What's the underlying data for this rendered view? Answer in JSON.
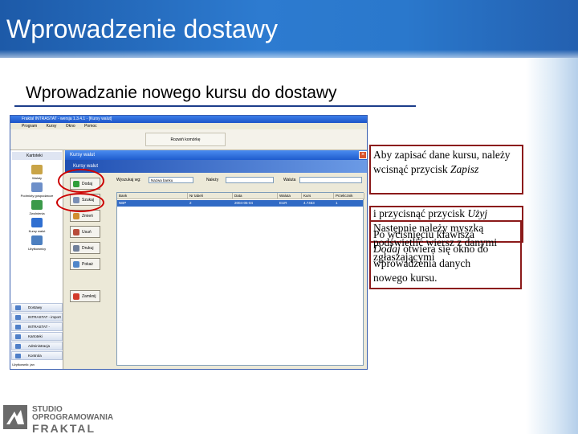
{
  "header": {
    "title": "Wprowadzenie dostawy"
  },
  "subtitle": "Wprowadzanie nowego kursu do dostawy",
  "app": {
    "window_title": "Fraktal INTRASTAT - wersja 1.3.4.1 - [Kursy walut]",
    "menu": [
      "Program",
      "Kursy",
      "Okno",
      "Pomoc"
    ],
    "toolbar_button": "Rozwiń komórkę",
    "sidebar": {
      "header": "Kartoteki",
      "items": [
        "Waluty",
        "Podmioty gospodarcze",
        "Zwolnienia",
        "Kursy walut",
        "Użytkownicy"
      ],
      "nav": [
        "Dostawy",
        "INTRASTAT - import",
        "INTRASTAT - eksport",
        "Kartoteki",
        "Administracja",
        "Kontrola"
      ],
      "status": "Użytkownik: jan"
    },
    "dialog": {
      "title": "Kursy walut",
      "heading": "Kursy walut",
      "buttons": [
        "Dodaj",
        "Szukaj",
        "Zmień",
        "Usuń",
        "Drukuj",
        "Pokaż",
        "Zamknij"
      ],
      "filter_label_1": "Wyszukaj wg:",
      "filter_value_1": "Nazwa banku",
      "filter_label_2": "Należy",
      "filter_label_3": "Waluta",
      "columns": [
        "Bank",
        "Nr tabeli",
        "Data",
        "Waluta",
        "Kurs",
        "Przelicznik"
      ],
      "row": [
        "NBP",
        "2",
        "2004-05-04",
        "EUR",
        "4.7463",
        "1"
      ]
    }
  },
  "callouts": {
    "first": {
      "text": "Aby zapisać dane kursu, należy wcisnąć przycisk ",
      "emphasis": "Zapisz"
    },
    "second_line1": "i przycisnąć przycisk ",
    "second_emph1": "Użyj",
    "second_line2": "Następnie należy myszką",
    "second_line3": "podświetlić wiersz z danymi",
    "second_line4": "zgłaszającymi",
    "third_line1": "Po wciśnięciu klawisza",
    "third_emph": "Dodaj",
    "third_line2": " otwiera się okno do",
    "third_line3": "wprowadzenia danych",
    "third_line4": "nowego kursu."
  },
  "logo": {
    "line1": "STUDIO",
    "line2": "OPROGRAMOWANIA",
    "line3": "FRAKTAL"
  },
  "colors": {
    "header_blue": "#2d7bd0",
    "callout_border": "#8b1a1a",
    "highlight_red": "#cc0000"
  }
}
